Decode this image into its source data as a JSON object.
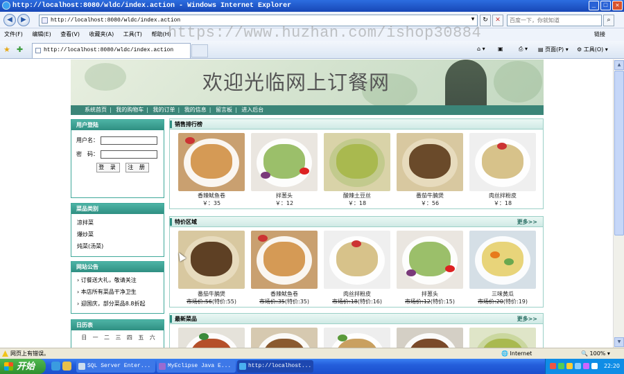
{
  "window": {
    "title": "http://localhost:8080/wldc/index.action - Windows Internet Explorer",
    "controls": [
      "_",
      "□",
      "✕"
    ]
  },
  "address_bar": {
    "url": "http://localhost:8080/wldc/index.action",
    "search_placeholder": "百度一下，你就知道"
  },
  "menu": {
    "items": [
      "文件(F)",
      "编辑(E)",
      "查看(V)",
      "收藏夹(A)",
      "工具(T)",
      "帮助(H)"
    ],
    "links_label": "链接"
  },
  "watermark": "https://www.huzhan.com/ishop30884",
  "favorites_bar": {
    "tab_title": "http://localhost:8080/wldc/index.action",
    "page_menu": "页面(P)",
    "tools_menu": "工具(O)"
  },
  "site": {
    "title": "欢迎光临网上订餐网",
    "nav": [
      "系统首页",
      "我的购物车",
      "我的订单",
      "我的信息",
      "留言板",
      "进入后台"
    ]
  },
  "login": {
    "heading": "用户登陆",
    "username_label": "用户名：",
    "password_label": "密　码：",
    "login_button": "登 录",
    "register_button": "注 册"
  },
  "categories": {
    "heading": "菜品类别",
    "items": [
      "凉拌菜",
      "爆炒菜",
      "炖菜(汤菜)"
    ]
  },
  "notices": {
    "heading": "网站公告",
    "items": [
      "订餐送大礼，敬请关注",
      "本店所有菜品干净卫生",
      "迎国庆，部分菜品8.8折起"
    ]
  },
  "calendar": {
    "heading": "日历表",
    "weekdays": [
      "日",
      "一",
      "二",
      "三",
      "四",
      "五",
      "六"
    ]
  },
  "sections": {
    "bestsellers": {
      "heading": "销售排行榜",
      "items": [
        {
          "name": "香辣鱿鱼卷",
          "price": "￥：35"
        },
        {
          "name": "拌葱头",
          "price": "￥：12"
        },
        {
          "name": "酸辣土豆丝",
          "price": "￥：18"
        },
        {
          "name": "番茄牛腩煲",
          "price": "￥：56"
        },
        {
          "name": "肉丝拌粉皮",
          "price": "￥：18"
        }
      ]
    },
    "specials": {
      "heading": "特价区域",
      "more": "更多>>",
      "items": [
        {
          "name": "番茄牛腩煲",
          "market": "市场价:56",
          "special": "(特价:55)"
        },
        {
          "name": "香辣鱿鱼卷",
          "market": "市场价:35",
          "special": "(特价:35)"
        },
        {
          "name": "肉丝拌粉皮",
          "market": "市场价:18",
          "special": "(特价:16)"
        },
        {
          "name": "拌葱头",
          "market": "市场价:12",
          "special": "(特价:15)"
        },
        {
          "name": "三味黄瓜",
          "market": "市场价:20",
          "special": "(特价:19)"
        }
      ]
    },
    "newest": {
      "heading": "最新菜品",
      "more": "更多>>"
    }
  },
  "status_bar": {
    "message": "网页上有错误。",
    "zone": "Internet",
    "zoom": "100%"
  },
  "taskbar": {
    "start": "开始",
    "tasks": [
      "SQL Server Enter...",
      "MyEclipse Java E...",
      "http://localhost..."
    ],
    "clock": "22:20"
  },
  "colors": {
    "nav_bar": "#3b8578",
    "side_heading": "#2f8f82",
    "titlebar": "#1747b6",
    "taskbar": "#245edb"
  }
}
